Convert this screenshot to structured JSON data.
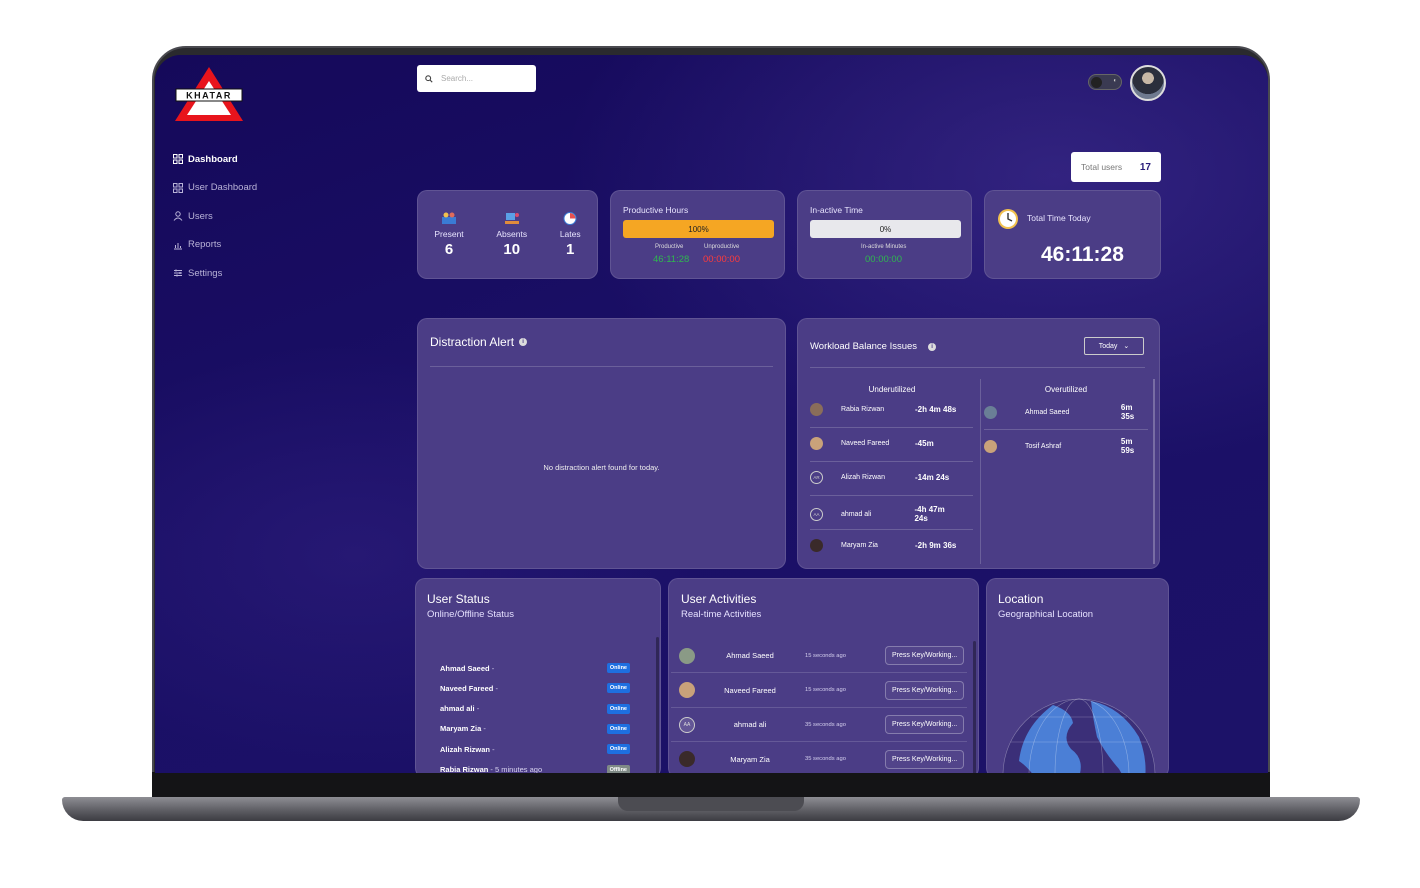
{
  "brand": {
    "name": "KHATAR"
  },
  "search": {
    "placeholder": "Search..."
  },
  "theme_toggle": {
    "label": "◐"
  },
  "nav": [
    {
      "label": "Dashboard",
      "icon": "grid-icon",
      "active": true
    },
    {
      "label": "User Dashboard",
      "icon": "grid-icon",
      "active": false
    },
    {
      "label": "Users",
      "icon": "user-icon",
      "active": false
    },
    {
      "label": "Reports",
      "icon": "chart-icon",
      "active": false
    },
    {
      "label": "Settings",
      "icon": "sliders-icon",
      "active": false
    }
  ],
  "total_users": {
    "label": "Total users",
    "value": "17"
  },
  "attendance": {
    "present": {
      "label": "Present",
      "value": "6"
    },
    "absents": {
      "label": "Absents",
      "value": "10"
    },
    "lates": {
      "label": "Lates",
      "value": "1"
    }
  },
  "productive": {
    "title": "Productive Hours",
    "bar_label": "100%",
    "bar_fraction": 1.0,
    "productive_label": "Productive",
    "productive_value": "46:11:28",
    "unproductive_label": "Unproductive",
    "unproductive_value": "00:00:00"
  },
  "inactive": {
    "title": "In-active Time",
    "bar_label": "0%",
    "bar_fraction": 0,
    "minutes_label": "In-active Minutes",
    "minutes_value": "00:00:00"
  },
  "total_time": {
    "title": "Total Time Today",
    "value": "46:11:28"
  },
  "distraction": {
    "title": "Distraction Alert",
    "empty_message": "No distraction alert found for today."
  },
  "workload": {
    "title": "Workload Balance Issues",
    "filter_value": "Today",
    "underutilized_title": "Underutilized",
    "overutilized_title": "Overutilized",
    "underutilized": [
      {
        "name": "Rabia Rizwan",
        "time": "-2h 4m 48s",
        "initials": ""
      },
      {
        "name": "Naveed Fareed",
        "time": "-45m",
        "initials": ""
      },
      {
        "name": "Alizah Rizwan",
        "time": "-14m 24s",
        "initials": "AR"
      },
      {
        "name": "ahmad ali",
        "time": "-4h 47m 24s",
        "initials": "AA"
      },
      {
        "name": "Maryam Zia",
        "time": "-2h 9m 36s",
        "initials": ""
      }
    ],
    "overutilized": [
      {
        "name": "Ahmad Saeed",
        "time": "6m 35s"
      },
      {
        "name": "Tosif Ashraf",
        "time": "5m 59s"
      }
    ]
  },
  "user_status": {
    "title": "User Status",
    "subtitle": "Online/Offline Status",
    "rows": [
      {
        "name": "Ahmad Saeed",
        "suffix": " -",
        "status": "Online"
      },
      {
        "name": "Naveed Fareed",
        "suffix": " -",
        "status": "Online"
      },
      {
        "name": "ahmad ali",
        "suffix": " -",
        "status": "Online"
      },
      {
        "name": "Maryam Zia",
        "suffix": " -",
        "status": "Online"
      },
      {
        "name": "Alizah Rizwan",
        "suffix": " -",
        "status": "Online"
      },
      {
        "name": "Rabia Rizwan",
        "suffix": " - 5 minutes ago",
        "status": "Offline"
      }
    ]
  },
  "activities": {
    "title": "User Activities",
    "subtitle": "Real-time Activities",
    "rows": [
      {
        "name": "Ahmad Saeed",
        "time": "15 seconds ago",
        "action": "Press Key/Working...",
        "initials": ""
      },
      {
        "name": "Naveed Fareed",
        "time": "15 seconds ago",
        "action": "Press Key/Working...",
        "initials": ""
      },
      {
        "name": "ahmad ali",
        "time": "35 seconds ago",
        "action": "Press Key/Working...",
        "initials": "AA"
      },
      {
        "name": "Maryam Zia",
        "time": "35 seconds ago",
        "action": "Press Key/Working...",
        "initials": ""
      }
    ]
  },
  "location": {
    "title": "Location",
    "subtitle": "Geographical Location"
  },
  "colors": {
    "accent_orange": "#f5a623",
    "productive_green": "#2fb84f",
    "unproductive_red": "#ff3b3b",
    "online_blue": "#1e6fe0"
  }
}
